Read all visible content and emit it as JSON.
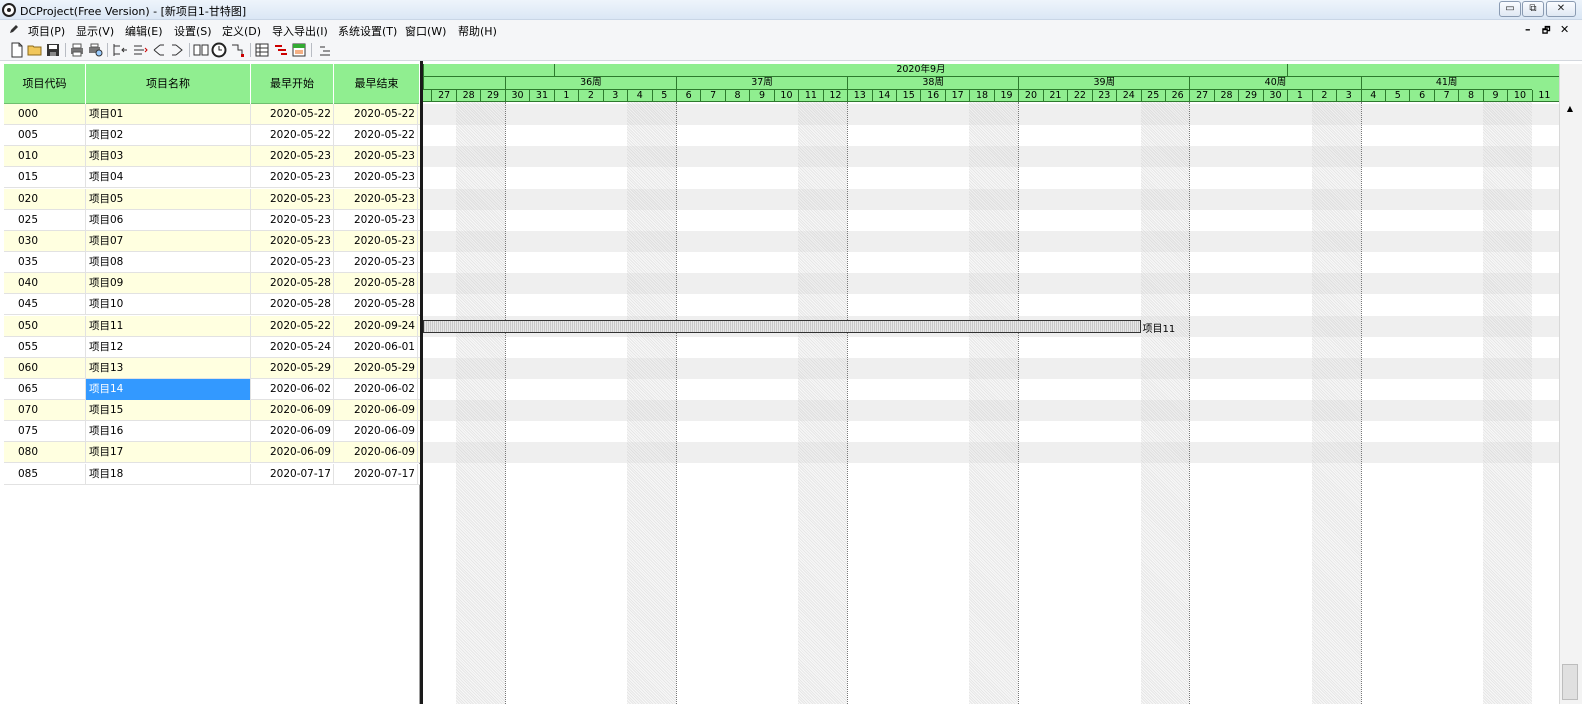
{
  "window": {
    "title": "DCProject(Free Version) - [新项目1-甘特图]"
  },
  "menu": [
    {
      "label": "项目(P)"
    },
    {
      "label": "显示(V)"
    },
    {
      "label": "编辑(E)"
    },
    {
      "label": "设置(S)"
    },
    {
      "label": "定义(D)"
    },
    {
      "label": "导入导出(I)"
    },
    {
      "label": "系统设置(T)"
    },
    {
      "label": "窗口(W)"
    },
    {
      "label": "帮助(H)"
    }
  ],
  "mdi_controls": {
    "minimize": "–",
    "restore": "🗗",
    "close": "✕"
  },
  "toolbar_icons": [
    "new-file-icon",
    "open-folder-icon",
    "save-icon",
    "print-icon",
    "print-preview-icon",
    "outdent-icon",
    "indent-icon",
    "link-icon",
    "unlink-icon",
    "book-icon",
    "clock-icon",
    "hierarchy-icon",
    "table-icon",
    "gantt-icon",
    "calendar-icon",
    "level-icon"
  ],
  "grid": {
    "columns": [
      "项目代码",
      "项目名称",
      "最早开始",
      "最早结束"
    ],
    "rows": [
      {
        "code": "000",
        "name": "项目01",
        "start": "2020-05-22",
        "end": "2020-05-22"
      },
      {
        "code": "005",
        "name": "项目02",
        "start": "2020-05-22",
        "end": "2020-05-22"
      },
      {
        "code": "010",
        "name": "项目03",
        "start": "2020-05-23",
        "end": "2020-05-23"
      },
      {
        "code": "015",
        "name": "项目04",
        "start": "2020-05-23",
        "end": "2020-05-23"
      },
      {
        "code": "020",
        "name": "项目05",
        "start": "2020-05-23",
        "end": "2020-05-23"
      },
      {
        "code": "025",
        "name": "项目06",
        "start": "2020-05-23",
        "end": "2020-05-23"
      },
      {
        "code": "030",
        "name": "项目07",
        "start": "2020-05-23",
        "end": "2020-05-23"
      },
      {
        "code": "035",
        "name": "项目08",
        "start": "2020-05-23",
        "end": "2020-05-23"
      },
      {
        "code": "040",
        "name": "项目09",
        "start": "2020-05-28",
        "end": "2020-05-28"
      },
      {
        "code": "045",
        "name": "项目10",
        "start": "2020-05-28",
        "end": "2020-05-28"
      },
      {
        "code": "050",
        "name": "项目11",
        "start": "2020-05-22",
        "end": "2020-09-24"
      },
      {
        "code": "055",
        "name": "项目12",
        "start": "2020-05-24",
        "end": "2020-06-01"
      },
      {
        "code": "060",
        "name": "项目13",
        "start": "2020-05-29",
        "end": "2020-05-29"
      },
      {
        "code": "065",
        "name": "项目14",
        "start": "2020-06-02",
        "end": "2020-06-02",
        "selected": true
      },
      {
        "code": "070",
        "name": "项目15",
        "start": "2020-06-09",
        "end": "2020-06-09"
      },
      {
        "code": "075",
        "name": "项目16",
        "start": "2020-06-09",
        "end": "2020-06-09"
      },
      {
        "code": "080",
        "name": "项目17",
        "start": "2020-06-09",
        "end": "2020-06-09"
      },
      {
        "code": "085",
        "name": "项目18",
        "start": "2020-07-17",
        "end": "2020-07-17"
      }
    ]
  },
  "gantt": {
    "month_label": "2020年9月",
    "weeks": [
      "36周",
      "37周",
      "38周",
      "39周",
      "40周",
      "41周"
    ],
    "days": [
      "6",
      "27",
      "28",
      "29",
      "30",
      "31",
      "1",
      "2",
      "3",
      "4",
      "5",
      "6",
      "7",
      "8",
      "9",
      "10",
      "11",
      "12",
      "13",
      "14",
      "15",
      "16",
      "17",
      "18",
      "19",
      "20",
      "21",
      "22",
      "23",
      "24",
      "25",
      "26",
      "27",
      "28",
      "29",
      "30",
      "1",
      "2",
      "3",
      "4",
      "5",
      "6",
      "7",
      "8",
      "9",
      "10",
      "11"
    ],
    "bars": [
      {
        "row": 10,
        "start": "2020-05-22",
        "end": "2020-09-24",
        "label": "项目11"
      }
    ]
  },
  "colors": {
    "header_green": "#90ee90",
    "odd_row": "#ffffe0",
    "selection": "#3399ff"
  }
}
